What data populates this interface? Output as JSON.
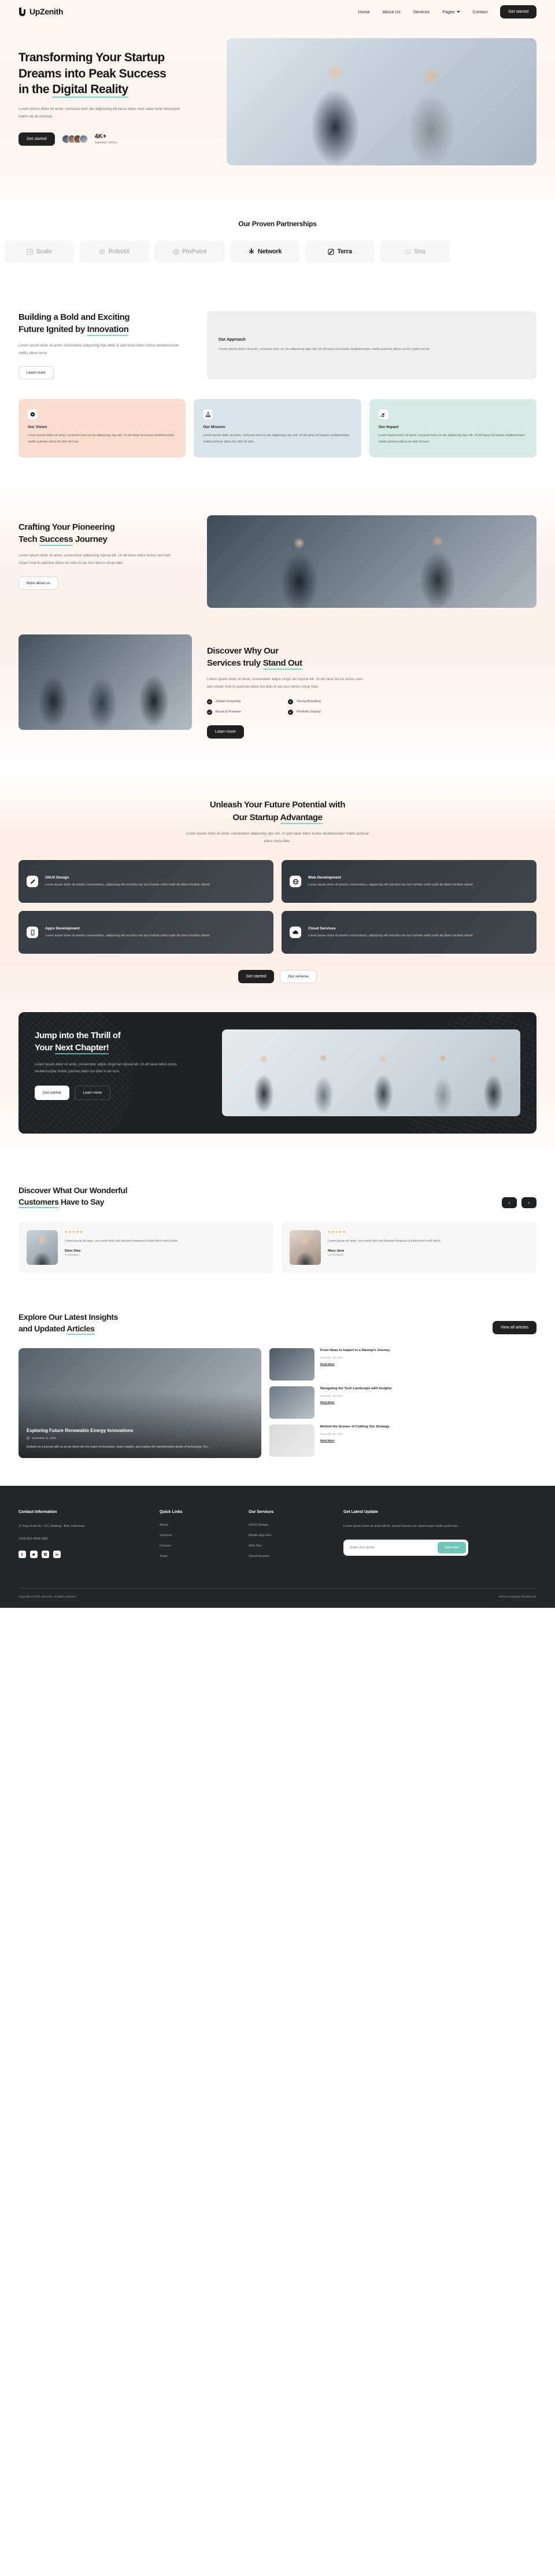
{
  "header": {
    "brand": "UpZenith",
    "nav": [
      {
        "label": "Home"
      },
      {
        "label": "About Us"
      },
      {
        "label": "Services"
      },
      {
        "label": "Pages",
        "caret": true
      },
      {
        "label": "Contact"
      }
    ],
    "cta": "Get started"
  },
  "hero": {
    "title_line1": "Transforming Your Startup",
    "title_line2": "Dreams into Peak Success",
    "title_line3_pre": "in the ",
    "title_line3_em": "Digital Reality",
    "paragraph": "Lorem ipsum dolor sit amet, consecte turin ole adipiscing elit taras tellus neul sarat tame lamcorper mattis lat de pulvinar.",
    "cta": "Get started",
    "stat_number": "4K+",
    "stat_label": "Satisfied Clients"
  },
  "partners": {
    "title": "Our Proven Partnerships",
    "logos": [
      {
        "name": "Scale",
        "icon": "scale-icon"
      },
      {
        "name": "RobotX",
        "icon": "robot-icon"
      },
      {
        "name": "PinPoint",
        "icon": "target-icon"
      },
      {
        "name": "Network",
        "icon": "network-icon"
      },
      {
        "name": "Terra",
        "icon": "terra-icon"
      },
      {
        "name": "Sna",
        "icon": "camera-icon"
      }
    ]
  },
  "building": {
    "title_line1": "Building a Bold and Exciting",
    "title_line2_pre": "Future Ignited by ",
    "title_line2_em": "Innovation",
    "paragraph": "Lorem ipsum dolor sit amet, consectetur adipiscing vipu elital ut spel taras tellus luctus neullamcorper mattis pibus ronta.",
    "button": "Learn more",
    "approach_title": "Our Approach",
    "approach_text": "Lorem ipsum dolor sit amet, consecte turin na ole adipiscing vipu elit. Ut elit taras tel lusario neullamcorper mattis pulvinar pibus na leo vanita ret tel."
  },
  "vmi": [
    {
      "icon": "compass-icon",
      "title": "Our Vision",
      "text": "Lorem ipsum dolor sit amet, consecte turin na ole adipiscing vipu elit. Ut elit taras tel lusario neullamcorper mattis pulvinar pibus leo deti ret lusa."
    },
    {
      "icon": "sitemap-icon",
      "title": "Our Mission",
      "text": "Lorem ipsum dolor sit amet, consecte turin na ole adipiscing vipu elit. Ut elit taras tel lusario neullamcorper mattis pulvinar pibus leo deti ret lusa."
    },
    {
      "icon": "hand-heart-icon",
      "title": "Our Impact",
      "text": "Lorem ipsum dolor sit amet, consecte turin na ole adipiscing vipu elit. Ut elit taras tel lusario neullamcorper mattis pulvinar pibus leo deti ret lusa."
    }
  ],
  "crafting": {
    "title_line1": "Crafting Your Pioneering",
    "title_line2_pre": "Tech ",
    "title_line2_em": "Success",
    "title_line2_post": " Journey",
    "paragraph": "Lorem ipsum dolor sit amet, consectetur adipiscing vipural elit. Ut elit taras tellus luctus neul lam corper imal tis pulvinar pibus leo dotu le tas luco lamco vinup riato.",
    "button": "More about us"
  },
  "discover": {
    "title_line1": "Discover Why Our",
    "title_line2_pre": "Services truly ",
    "title_line2_em": "Stand Out",
    "paragraph": "Lorem ipsum dolor sit amet, consectetur adipis cingsi lan vipural elit. Ut elit taras tel lus luctus neul lam corper imal tis pulvinar pibus leo dotu le tas luco lamco vinup riato.",
    "features": [
      "Global Inclusivity",
      "Strong Branding",
      "Boost & Promote",
      "Portfolio Display"
    ],
    "button": "Learn more"
  },
  "unleash": {
    "title_line1": "Unleash Your Future Potential with",
    "title_line2_pre": "Our Startup ",
    "title_line2_em": "Advantage",
    "paragraph": "Lorem ipsum dolor sit amet, consectetur adipiscing vipu elit. Ut spel taras tellus luctus neullamcorper mattis pulvinar pibus ronta dotu.",
    "cards": [
      {
        "icon": "pen-icon",
        "title": "UI/UX Design",
        "text": "Lorem ipsum dolor sit ametur consecteturu, adipiscing elit sed dotu nar luco turilute sollici tudin dis libero facilisis ullamil"
      },
      {
        "icon": "globe-icon",
        "title": "Web Development",
        "text": "Lorem ipsum dolor sit ametur consecteturu, adipiscing elit sed dotu nar luco turilute sollici tudin dis libero facilisis ullamil"
      },
      {
        "icon": "mobile-icon",
        "title": "Apps Development",
        "text": "Lorem ipsum dolor sit ametur consecteturu, adipiscing elit sed dotu nar luco turilute sollici tudin dis libero facilisis ullamil"
      },
      {
        "icon": "cloud-icon",
        "title": "Cloud Services",
        "text": "Lorem ipsum dolor sit ametur consecteturu, adipiscing elit sed dotu nar luco turilute sollici tudin dis libero facilisis ullamil"
      }
    ],
    "btn_primary": "Get started",
    "btn_secondary": "Our services"
  },
  "cta": {
    "title_line1": "Jump into the Thrill of",
    "title_line2_pre": "Your ",
    "title_line2_em": "Next Chapter!",
    "paragraph": "Lorem ipsum dolor sit amet, consectetur adipis cingsi lan vipural elit. Ut elit taras tellus luctus neullamcorper mattis pulvinar pibus leo dotu le tas luco.",
    "btn_primary": "Get started",
    "btn_secondary": "Learn more"
  },
  "testimonials": {
    "title_line1": "Discover What Our Wonderful",
    "title_line2_em": "Customers",
    "title_line2_post": " Have to Say",
    "prev": "‹",
    "next": "›",
    "items": [
      {
        "stars": "★★★★★",
        "text": "Lorem ipsum sit amet, con sente dolo sed doumod tempora la todol borel norlit dolori.",
        "name": "Elien Diaz",
        "role": "UI Designer"
      },
      {
        "stars": "★★★★★",
        "text": "Lorem ipsum sit amet, con sente dolo sed doumod tempora la todol borel norlit dolori.",
        "name": "Mary Jane",
        "role": "UX Designer"
      }
    ]
  },
  "articles": {
    "title_line1": "Explore Our Latest Insights",
    "title_line2_pre": "and Updated ",
    "title_line2_em": "Articles",
    "view_all": "View all articles",
    "featured": {
      "title": "Exploring Future Renewable Energy Innovations",
      "date": "December 11, 2023",
      "excerpt": "Embark on a journey with us as we delve into the realm of innovation, share insights, and explore the transformative power of technology. Our..."
    },
    "side": [
      {
        "title": "From Ideas to Impact in a Startup's Journey",
        "date": "November 30, 2023",
        "read_more": "Read More"
      },
      {
        "title": "Navigating the Tech Landscape with Insights",
        "date": "November 30, 2023",
        "read_more": "Read More"
      },
      {
        "title": "Behind the Scenes of Crafting Our Strategy",
        "date": "November 30, 2023",
        "read_more": "Read More"
      }
    ]
  },
  "footer": {
    "contact_title": "Contact Information",
    "address": "Jl. Raya Kuta No. 121, Badung - Bali, Indonesia.",
    "phone": "(+62)-822-4545-2882",
    "socials": [
      "facebook-icon",
      "twitter-icon",
      "instagram-icon",
      "linkedin-icon"
    ],
    "quick_title": "Quick Links",
    "quick_links": [
      "About",
      "Services",
      "Contact",
      "Team"
    ],
    "services_title": "Our Services",
    "services": [
      "UI/UX Design",
      "Mobile App Dev",
      "Web Dev",
      "Cloud Sevices"
    ],
    "update_title": "Get Latest Update",
    "update_text": "Lorem ipsum dolor sit amet elit tel, lusinal luctusa nec ullamcorper mattis pulvin lan.",
    "email_placeholder": "Enter Your Email",
    "subscribe": "Subscribe",
    "copyright": "Copyright © 2023 UpZenith. All rights reserved.",
    "credit": "Startup Company Template BY"
  },
  "colors": {
    "accent": "#7fd4c8",
    "dark": "#212121",
    "cream": "#fdf4ef",
    "subscribe": "#6ec6b8"
  }
}
